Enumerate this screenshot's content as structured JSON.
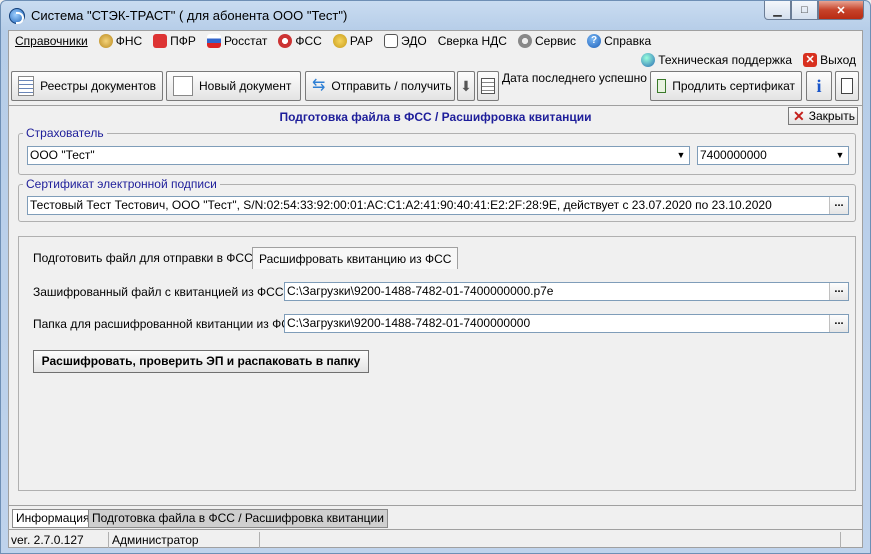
{
  "window": {
    "title": "Система \"СТЭК-ТРАСТ\" ( для абонента ООО \"Тест\")"
  },
  "menu": {
    "items": [
      {
        "label": "Справочники",
        "icon": ""
      },
      {
        "label": "ФНС",
        "icon": "fns-icon"
      },
      {
        "label": "ПФР",
        "icon": "pfr-icon"
      },
      {
        "label": "Росстат",
        "icon": "rosstat-icon"
      },
      {
        "label": "ФСС",
        "icon": "fss-icon"
      },
      {
        "label": "РАР",
        "icon": "rar-icon"
      },
      {
        "label": "ЭДО",
        "icon": "edo-icon"
      },
      {
        "label": "Сверка НДС",
        "icon": ""
      },
      {
        "label": "Сервис",
        "icon": "gear-icon"
      },
      {
        "label": "Справка",
        "icon": "help-icon"
      }
    ],
    "support_label": "Техническая поддержка",
    "exit_label": "Выход"
  },
  "toolbar": {
    "registries_label": "Реестры документов",
    "new_doc_label": "Новый документ",
    "send_receive_label": "Отправить / получить",
    "last_success_label": "Дата последнего успешного",
    "extend_cert_label": "Продлить сертификат"
  },
  "panel": {
    "title": "Подготовка файла в ФСС / Расшифровка квитанции",
    "close_label": "Закрыть"
  },
  "insurer": {
    "legend": "Страхователь",
    "value": "ООО \"Тест\"",
    "inn": "7400000000"
  },
  "certificate": {
    "legend": "Сертификат электронной подписи",
    "value": "Тестовый Тест Тестович, ООО \"Тест\", S/N:02:54:33:92:00:01:AC:C1:A2:41:90:40:41:E2:2F:28:9E, действует с 23.07.2020 по 23.10.2020"
  },
  "tabs": [
    {
      "label": "Подготовить файл для отправки в ФСС"
    },
    {
      "label": "Расшифровать квитанцию из ФСС"
    }
  ],
  "decrypt": {
    "encrypted_file_label": "Зашифрованный файл с квитанцией из ФСС",
    "encrypted_file_value": "C:\\Загрузки\\9200-1488-7482-01-7400000000.p7e",
    "folder_label": "Папка для расшифрованной квитанции из ФСС",
    "folder_value": "C:\\Загрузки\\9200-1488-7482-01-7400000000",
    "action_label": "Расшифровать, проверить ЭП и распаковать в папку"
  },
  "bottom_tabs": [
    {
      "label": "Информация"
    },
    {
      "label": "Подготовка файла в ФСС / Расшифровка квитанции"
    }
  ],
  "statusbar": {
    "version": "ver. 2.7.0.127",
    "user": "Администратор"
  },
  "ellipsis": "..."
}
